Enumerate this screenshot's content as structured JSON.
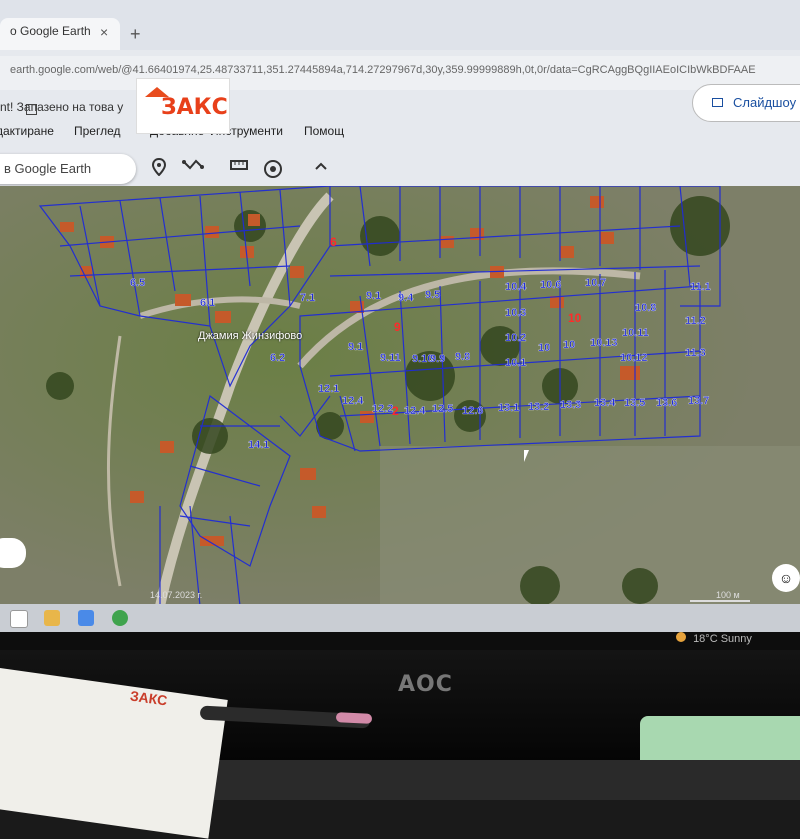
{
  "browser": {
    "tab_title": "o Google Earth",
    "new_tab": "+",
    "url": "earth.google.com/web/@41.66401974,25.48733711,351.27445894a,714.27297967d,30y,359.99999889h,0t,0r/data=CgRCAggBQgIIAEoICIbWkBDFAAE",
    "saved_text": "nt!   Запазено на това у",
    "slideshow_label": "Слайдшоу"
  },
  "logo": {
    "text": "ЗАКС"
  },
  "menu": {
    "items": [
      "дактиране",
      "Преглед",
      "Добавяне",
      "Инструменти",
      "Помощ"
    ]
  },
  "toolbar": {
    "search_placeholder": "в Google Earth",
    "icons": [
      "pin-icon",
      "path-icon",
      "ruler-icon",
      "history-icon",
      "chevron-up-icon"
    ]
  },
  "map": {
    "place_label": "Джамия Жинзифово",
    "parcels": [
      "6.1",
      "6",
      "7.1",
      "7",
      "8",
      "9.1",
      "9.4",
      "9.5",
      "9",
      "10.2",
      "10.4",
      "10.5",
      "10.6",
      "10.7",
      "10.8",
      "10.9",
      "10.10",
      "10.11",
      "10.12",
      "10.13",
      "10.15",
      "11.2",
      "11.3",
      "11.4",
      "11.5",
      "11.6",
      "11.7",
      "11.8",
      "11.9",
      "12.1",
      "12.2",
      "12.4",
      "12.5",
      "12.6",
      "13.1",
      "13.2",
      "13.3",
      "13.4",
      "13.5",
      "13.6",
      "13.7",
      "10"
    ],
    "highlight_parcels": [
      "9",
      "10",
      "6"
    ],
    "date_text": "14.07.2023 г.",
    "scale_text": "100 м"
  },
  "taskbar": {
    "weather": "18°C  Sunny"
  },
  "monitor": {
    "brand": "AOC"
  },
  "desk": {
    "paper_logo": "ЗАКС"
  },
  "colors": {
    "parcel_lines": "#1f2bd6",
    "highlight": "#ff2a2a",
    "logo_red": "#e8401a",
    "slides_blue": "#1a4fa0"
  }
}
